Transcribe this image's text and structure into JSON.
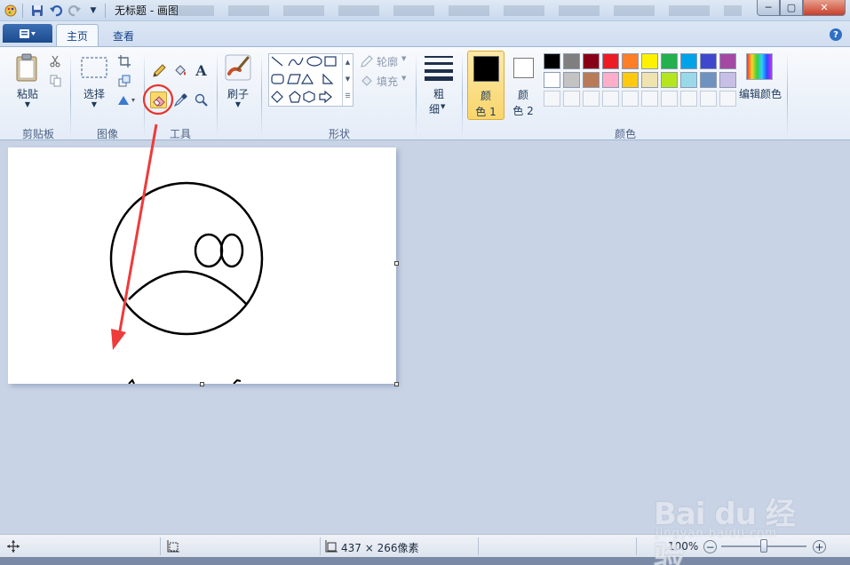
{
  "window": {
    "title": "无标题 - 画图",
    "buttons": {
      "minimize": "─",
      "maximize": "▢",
      "close": "✕"
    }
  },
  "tabs": {
    "home": "主页",
    "view": "查看"
  },
  "ribbon": {
    "clipboard": {
      "paste": "粘贴",
      "group": "剪贴板"
    },
    "image": {
      "select": "选择",
      "group": "图像"
    },
    "tools": {
      "group": "工具",
      "text_glyph": "A",
      "active": "eraser"
    },
    "brushes": {
      "label": "刷子"
    },
    "shapes": {
      "outline": "轮廓",
      "fill": "填充",
      "group": "形状"
    },
    "size": {
      "line1": "粗",
      "line2": "细"
    },
    "colors": {
      "color1_a": "颜",
      "color1_b": "色 1",
      "color2_a": "颜",
      "color2_b": "色 2",
      "color1_value": "#000000",
      "color2_value": "#ffffff",
      "edit": "编辑颜色",
      "group": "颜色",
      "palette_row1": [
        "#000000",
        "#7f7f7f",
        "#880015",
        "#ed1c24",
        "#ff7f27",
        "#fff200",
        "#22b14c",
        "#00a2e8",
        "#3f48cc",
        "#a349a4"
      ],
      "palette_row2": [
        "#ffffff",
        "#c3c3c3",
        "#b97a57",
        "#ffaec9",
        "#ffc90e",
        "#efe4b0",
        "#b5e61d",
        "#99d9ea",
        "#7092be",
        "#c8bfe7"
      ]
    }
  },
  "statusbar": {
    "dimensions": "437 × 266像素",
    "zoom": "100%",
    "zoom_out": "−",
    "zoom_in": "+"
  },
  "watermark": {
    "main": "Bai du 经验",
    "url": "jingyan.baidu.com"
  },
  "colors": {
    "highlight_circle": "#e8332c",
    "annotation_arrow": "#ee3b3b",
    "active_tool_bg": "#fbd86a"
  }
}
